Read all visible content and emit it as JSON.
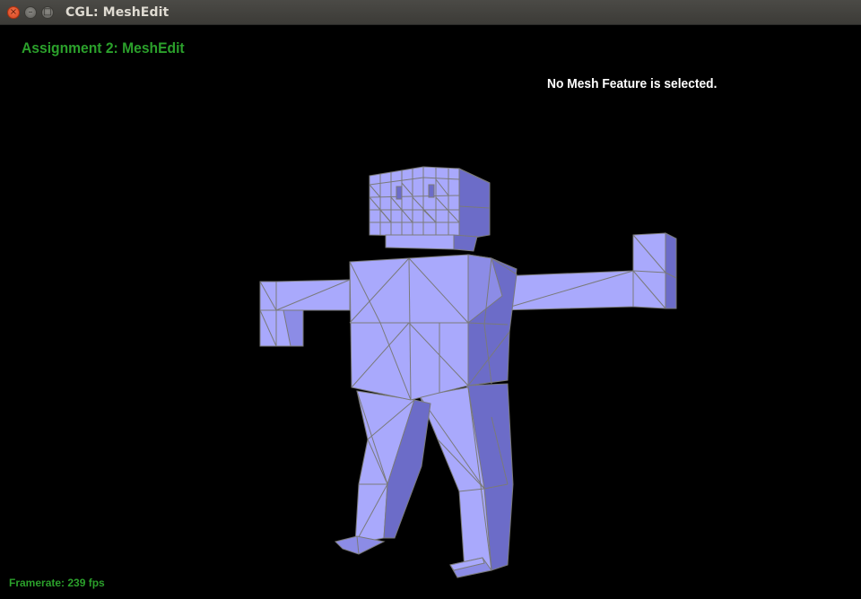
{
  "window": {
    "title": "CGL: MeshEdit",
    "buttons": {
      "close": "×",
      "minimize": "–",
      "maximize": "□"
    }
  },
  "overlay": {
    "heading": "Assignment 2: MeshEdit",
    "selection_status": "No Mesh Feature is selected.",
    "framerate": "Framerate: 239 fps"
  },
  "colors": {
    "background": "#000000",
    "heading_text": "#2ba02b",
    "status_text": "#ffffff",
    "mesh_light": "#a9a9fc",
    "mesh_shadow": "#6c6cc8",
    "wireframe": "#7a7a7a"
  },
  "viewport": {
    "model": "robot-mesh"
  }
}
